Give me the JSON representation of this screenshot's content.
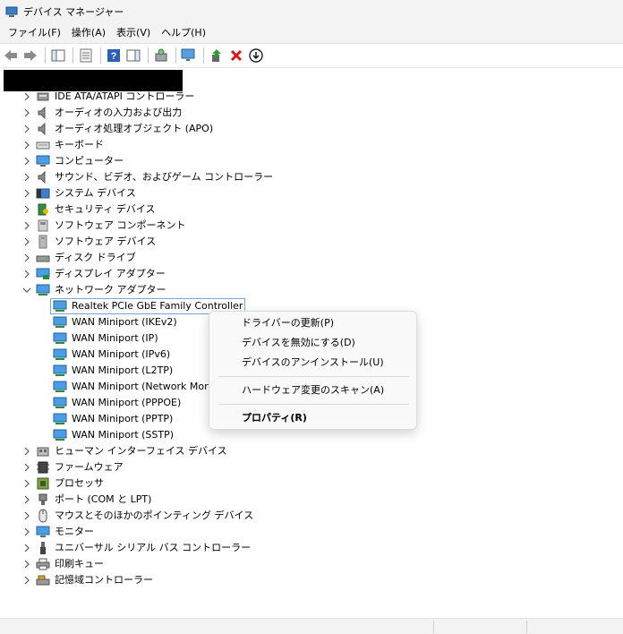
{
  "window": {
    "title": "デバイス マネージャー"
  },
  "menubar": {
    "file": "ファイル(F)",
    "action": "操作(A)",
    "view": "表示(V)",
    "help": "ヘルプ(H)"
  },
  "tree": {
    "categories": [
      {
        "label": "IDE ATA/ATAPI コントローラー",
        "icon": "ide-controller-icon"
      },
      {
        "label": "オーディオの入力および出力",
        "icon": "speaker-icon"
      },
      {
        "label": "オーディオ処理オブジェクト (APO)",
        "icon": "speaker-icon"
      },
      {
        "label": "キーボード",
        "icon": "keyboard-icon"
      },
      {
        "label": "コンピューター",
        "icon": "computer-icon"
      },
      {
        "label": "サウンド、ビデオ、およびゲーム コントローラー",
        "icon": "speaker-icon"
      },
      {
        "label": "システム デバイス",
        "icon": "system-device-icon"
      },
      {
        "label": "セキュリティ デバイス",
        "icon": "security-device-icon"
      },
      {
        "label": "ソフトウェア コンポーネント",
        "icon": "software-component-icon"
      },
      {
        "label": "ソフトウェア デバイス",
        "icon": "software-device-icon"
      },
      {
        "label": "ディスク ドライブ",
        "icon": "disk-drive-icon"
      },
      {
        "label": "ディスプレイ アダプター",
        "icon": "display-adapter-icon"
      },
      {
        "label": "ネットワーク アダプター",
        "icon": "network-adapter-icon"
      }
    ],
    "network_children": [
      {
        "label": "Realtek PCIe GbE Family Controller"
      },
      {
        "label": "WAN Miniport (IKEv2)"
      },
      {
        "label": "WAN Miniport (IP)"
      },
      {
        "label": "WAN Miniport (IPv6)"
      },
      {
        "label": "WAN Miniport (L2TP)"
      },
      {
        "label": "WAN Miniport (Network Mor"
      },
      {
        "label": "WAN Miniport (PPPOE)"
      },
      {
        "label": "WAN Miniport (PPTP)"
      },
      {
        "label": "WAN Miniport (SSTP)"
      }
    ],
    "categories_after": [
      {
        "label": "ヒューマン インターフェイス デバイス",
        "icon": "hid-icon"
      },
      {
        "label": "ファームウェア",
        "icon": "firmware-icon"
      },
      {
        "label": "プロセッサ",
        "icon": "processor-icon"
      },
      {
        "label": "ポート (COM と LPT)",
        "icon": "port-icon"
      },
      {
        "label": "マウスとそのほかのポインティング デバイス",
        "icon": "mouse-icon"
      },
      {
        "label": "モニター",
        "icon": "monitor-icon"
      },
      {
        "label": "ユニバーサル シリアル バス コントローラー",
        "icon": "usb-icon"
      },
      {
        "label": "印刷キュー",
        "icon": "printer-icon"
      },
      {
        "label": "記憶域コントローラー",
        "icon": "storage-controller-icon"
      }
    ]
  },
  "context_menu": {
    "update_driver": "ドライバーの更新(P)",
    "disable_device": "デバイスを無効にする(D)",
    "uninstall_device": "デバイスのアンインストール(U)",
    "scan_hardware": "ハードウェア変更のスキャン(A)",
    "properties": "プロパティ(R)"
  },
  "colors": {
    "selection_border": "#7aa6d6",
    "menu_bg": "#f9f9f9",
    "chrome_bg": "#f3f3f3"
  }
}
